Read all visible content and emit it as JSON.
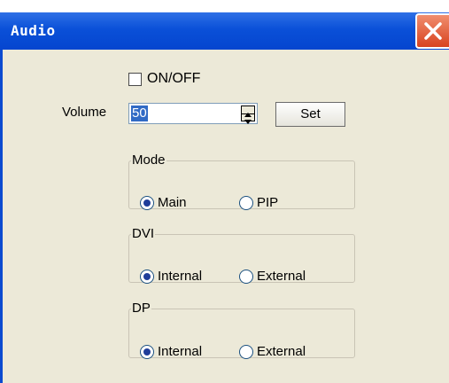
{
  "window": {
    "title": "Audio",
    "close_icon": "close-icon"
  },
  "onoff": {
    "label": "ON/OFF",
    "checked": false
  },
  "volume": {
    "label": "Volume",
    "value": "50",
    "set_label": "Set"
  },
  "groups": {
    "mode": {
      "legend": "Mode",
      "options": [
        "Main",
        "PIP"
      ],
      "selected": "Main"
    },
    "dvi": {
      "legend": "DVI",
      "options": [
        "Internal",
        "External"
      ],
      "selected": "Internal"
    },
    "dp": {
      "legend": "DP",
      "options": [
        "Internal",
        "External"
      ],
      "selected": "Internal"
    }
  },
  "colors": {
    "titlebar": "#0a50d8",
    "client": "#ece9d8",
    "selection": "#316ac5",
    "close": "#d8431f"
  }
}
